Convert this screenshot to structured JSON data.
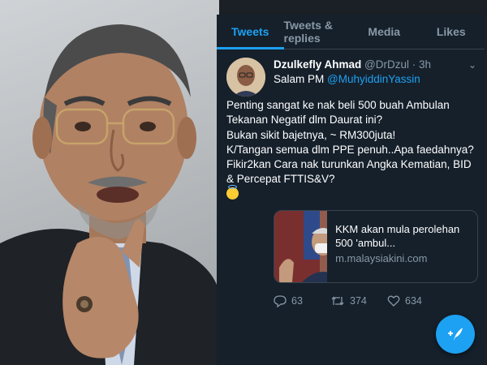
{
  "tabs": [
    {
      "label": "Tweets"
    },
    {
      "label": "Tweets & replies"
    },
    {
      "label": "Media"
    },
    {
      "label": "Likes"
    }
  ],
  "tweet": {
    "author_name": "Dzulkefly Ahmad",
    "handle": "@DrDzul",
    "time": "· 3h",
    "greeting": "Salam PM",
    "mention": "@MuhyiddinYassin",
    "lines": [
      "Penting sangat ke nak beli 500 buah Ambulan Tekanan Negatif dlm Daurat ini?",
      "Bukan sikit bajetnya, ~ RM300juta!",
      "K/Tangan semua dlm PPE penuh..Apa faedahnya?",
      "Fikir2kan Cara nak turunkan Angka Kematian, BID & Percepat FTTIS&V?"
    ],
    "card": {
      "title": "KKM akan mula perolehan 500 'ambul...",
      "domain": "m.malaysiakini.com"
    },
    "replies": "63",
    "retweets": "374",
    "likes": "634"
  },
  "colors": {
    "background": "#15202b",
    "accent": "#1da1f2",
    "muted": "#8899a6",
    "divider": "#38444d"
  },
  "icons": [
    "chevron-down-icon",
    "reply-icon",
    "retweet-icon",
    "like-icon",
    "compose-icon",
    "smiling-halo-emoji"
  ]
}
